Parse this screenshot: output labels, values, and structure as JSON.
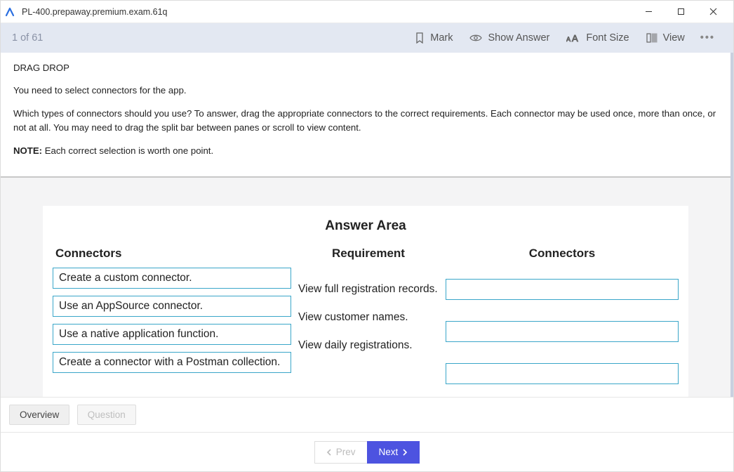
{
  "window": {
    "title": "PL-400.prepaway.premium.exam.61q"
  },
  "toolbar": {
    "counter": "1 of 61",
    "mark": "Mark",
    "show_answer": "Show Answer",
    "font_size": "Font Size",
    "view": "View",
    "more": "•••"
  },
  "question": {
    "type_label": "DRAG DROP",
    "line1": "You need to select connectors for the app.",
    "line2": "Which types of connectors should you use? To answer, drag the appropriate connectors to the correct requirements. Each connector may be used once, more than once, or not at all. You may need to drag the split bar between panes or scroll to view content.",
    "note_label": "NOTE:",
    "note_text": " Each correct selection is worth one point."
  },
  "answer": {
    "title": "Answer Area",
    "left_head": "Connectors",
    "mid_head": "Requirement",
    "right_head": "Connectors",
    "items": [
      "Create a custom connector.",
      "Use an AppSource connector.",
      "Use a native application function.",
      "Create a connector with a Postman collection."
    ],
    "requirements": [
      "View full registration records.",
      "View customer names.",
      "View daily registrations."
    ]
  },
  "tabs": {
    "overview": "Overview",
    "question": "Question"
  },
  "nav": {
    "prev": "Prev",
    "next": "Next"
  }
}
